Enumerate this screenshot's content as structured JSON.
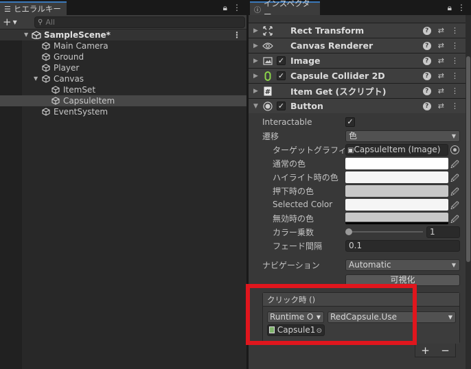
{
  "hierarchy": {
    "tab_label": "ヒエラルキー",
    "search_placeholder": "All",
    "scene_name": "SampleScene*",
    "items": [
      {
        "label": "Main Camera"
      },
      {
        "label": "Ground"
      },
      {
        "label": "Player"
      },
      {
        "label": "Canvas"
      },
      {
        "label": "ItemSet"
      },
      {
        "label": "CapsuleItem"
      },
      {
        "label": "EventSystem"
      }
    ]
  },
  "inspector": {
    "tab_label": "インスペクター",
    "components": [
      {
        "title": "Rect Transform"
      },
      {
        "title": "Canvas Renderer"
      },
      {
        "title": "Image"
      },
      {
        "title": "Capsule Collider 2D"
      },
      {
        "title": "Item Get (スクリプト)"
      },
      {
        "title": "Button"
      }
    ],
    "button": {
      "interactable_label": "Interactable",
      "transition_label": "遷移",
      "transition_value": "色",
      "target_graphic_label": "ターゲットグラフィックス",
      "target_graphic_value": "CapsuleItem (Image)",
      "normal_color_label": "通常の色",
      "highlight_color_label": "ハイライト時の色",
      "pressed_color_label": "押下時の色",
      "selected_color_label": "Selected Color",
      "disabled_color_label": "無効時の色",
      "color_multiplier_label": "カラー乗数",
      "color_multiplier_value": "1",
      "fade_duration_label": "フェード間隔",
      "fade_duration_value": "0.1",
      "navigation_label": "ナビゲーション",
      "navigation_value": "Automatic",
      "visualize_label": "可視化"
    },
    "onclick": {
      "header": "クリック時 ()",
      "runtime_value": "Runtime O",
      "function_value": "RedCapsule.Use",
      "object_value": "Capsule1",
      "plus_label": "+",
      "minus_label": "−"
    }
  },
  "colors": {
    "highlight_rect": "#e0161d",
    "normal": "#ffffff",
    "highlight": "#f5f5f5",
    "pressed": "#c8c8c8",
    "selected": "#f5f5f5",
    "disabled": "#c8c8c8"
  }
}
